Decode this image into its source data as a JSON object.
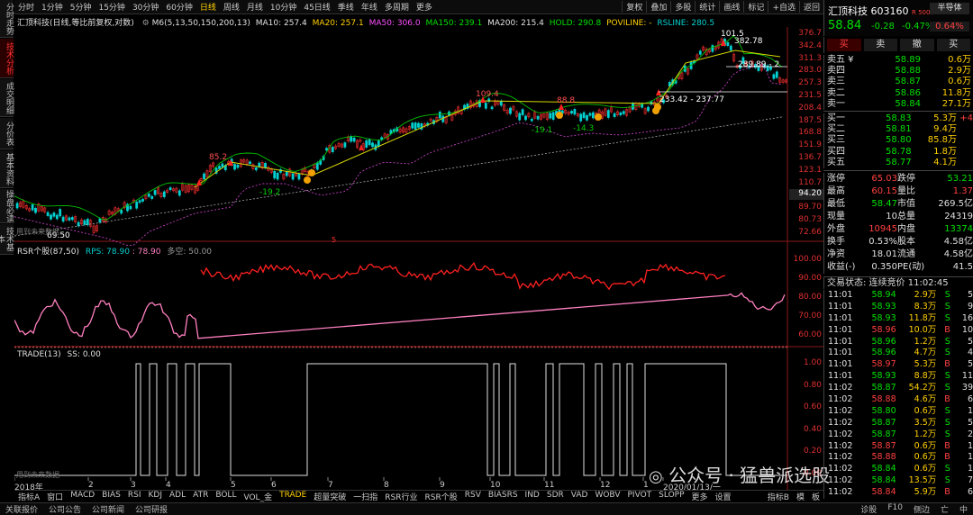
{
  "side_tabs": [
    {
      "label": "分时走势",
      "active": false
    },
    {
      "label": "技术分析",
      "active": true
    },
    {
      "label": "成交明细",
      "active": false
    },
    {
      "label": "分价表",
      "active": false
    },
    {
      "label": "基本资料",
      "active": false
    },
    {
      "label": "操盘必读",
      "active": false
    },
    {
      "label": "技术基本",
      "active": false
    }
  ],
  "timeframes": [
    "分时",
    "1分钟",
    "5分钟",
    "15分钟",
    "30分钟",
    "60分钟",
    "日线",
    "周线",
    "月线",
    "10分钟",
    "45日线",
    "季线",
    "年线",
    "多周期",
    "更多"
  ],
  "active_timeframe": "日线",
  "top_buttons": [
    "复权",
    "叠加",
    "多股",
    "统计",
    "画线",
    "标记",
    "+自选",
    "返回"
  ],
  "ma_line": {
    "name": "汇顶科技(日线,等比前复权,对数)",
    "m6": "M6(5,13,50,150,200,13)",
    "ma10": "MA10: 257.4",
    "ma20": "MA20: 257.1",
    "ma50": "MA50: 306.0",
    "ma150": "MA150: 239.1",
    "ma200": "MA200: 215.4",
    "hold": "HOLD: 290.8",
    "poviline": "POVILINE: -",
    "rsline": "RSLINE: 280.5"
  },
  "price_axis": [
    "376.7",
    "342.4",
    "311.3",
    "283.0",
    "257.3",
    "231.5",
    "208.4",
    "187.5",
    "168.8",
    "151.9",
    "136.7",
    "123.1",
    "110.7",
    "94.20",
    "89.70",
    "80.73",
    "72.66"
  ],
  "annotations": {
    "a1": "101.5",
    "a2": "382.78",
    "a3": "289.89 - 2",
    "a4": "233.42 - 237.77",
    "a5": "109.4",
    "a6": "88.8",
    "a7": "-19.1",
    "a8": "-14.3",
    "a9": "85.2",
    "a10": "-19.2",
    "a11": "69.50",
    "a12": "5",
    "a13": "用到未来数据"
  },
  "rsr_panel": {
    "title": "RSR个股(87,50)",
    "rps": "RPS: 78.90",
    "rps2": ": 78.90",
    "duo": "多空: 50.00",
    "axis": [
      "100.00",
      "90.00",
      "80.00",
      "70.00",
      "60.00"
    ]
  },
  "trade_panel": {
    "title": "TRADE(13)",
    "ss": "SS: 0.00",
    "axis": [
      "1.00",
      "0.80",
      "0.60",
      "0.40",
      "0.20",
      "0.00"
    ],
    "future": "用到未来数据"
  },
  "x_axis": [
    "2018年",
    "2",
    "3",
    "4",
    "5",
    "6",
    "7",
    "8",
    "9",
    "10",
    "11",
    "12",
    "1",
    "2020/01/13/一"
  ],
  "bottom_tabs": [
    "指标A",
    "窗口",
    "MACD",
    "BIAS",
    "RSI",
    "KDJ",
    "ADL",
    "ATR",
    "BOLL",
    "VOL_金",
    "TRADE",
    "超量突破",
    "一扫指",
    "RSR行业",
    "RSR个股",
    "RSV",
    "BIASRS",
    "IND",
    "SDR",
    "VAD",
    "WOBV",
    "PIVOT",
    "SLOPP",
    "更多",
    "设置"
  ],
  "active_bottom": "TRADE",
  "bottom_right": [
    "指标B",
    "模",
    "板"
  ],
  "status": {
    "items": [
      "关联报价",
      "公司公告",
      "公司新闻",
      "公司研报"
    ],
    "right": [
      "诊股",
      "F10",
      "侧边",
      "亡",
      "中"
    ]
  },
  "watermark": "公众号 · 猛兽派选股",
  "stock": {
    "name": "汇顶科技",
    "code": "603160",
    "tag": "R 500",
    "sector": "半导体",
    "price": "58.84",
    "change": "-0.28",
    "pct": "-0.47%",
    "sector_pct": "0.64%"
  },
  "trade_buttons": [
    "买",
    "卖",
    "撤",
    "买"
  ],
  "asks": [
    [
      "卖五 ¥",
      "58.89",
      "0.6万"
    ],
    [
      "卖四",
      "58.88",
      "2.9万"
    ],
    [
      "卖三",
      "58.87",
      "0.6万"
    ],
    [
      "卖二",
      "58.86",
      "11.8万"
    ],
    [
      "卖一",
      "58.84",
      "27.1万"
    ]
  ],
  "bids": [
    [
      "买一",
      "58.83",
      "5.3万",
      "+4"
    ],
    [
      "买二",
      "58.81",
      "9.4万",
      ""
    ],
    [
      "买三",
      "58.80",
      "85.8万",
      ""
    ],
    [
      "买四",
      "58.78",
      "1.8万",
      ""
    ],
    [
      "买五",
      "58.77",
      "4.1万",
      ""
    ]
  ],
  "stats": [
    [
      "涨停",
      "65.03",
      "跌停",
      "53.21"
    ],
    [
      "最高",
      "60.15",
      "量比",
      "1.37"
    ],
    [
      "最低",
      "58.47",
      "市值",
      "269.5亿"
    ],
    [
      "现量",
      "10",
      "总量",
      "24319"
    ],
    [
      "外盘",
      "10945",
      "内盘",
      "13374"
    ],
    [
      "换手",
      "0.53%",
      "股本",
      "4.58亿"
    ],
    [
      "净资",
      "18.01",
      "流通",
      "4.58亿"
    ],
    [
      "收益(-)",
      "0.350",
      "PE(动)",
      "41.5"
    ]
  ],
  "trade_status": "交易状态: 连续竞价 11:02:45",
  "ticks": [
    [
      "11:01",
      "58.94",
      "2.9万",
      "S",
      "5"
    ],
    [
      "11:01",
      "58.93",
      "8.3万",
      "S",
      "9"
    ],
    [
      "11:01",
      "58.93",
      "11.8万",
      "S",
      "16"
    ],
    [
      "11:01",
      "58.96",
      "10.0万",
      "B",
      "10"
    ],
    [
      "11:01",
      "58.96",
      "1.2万",
      "S",
      "5"
    ],
    [
      "11:01",
      "58.96",
      "4.7万",
      "S",
      "4"
    ],
    [
      "11:01",
      "58.97",
      "5.3万",
      "B",
      "5"
    ],
    [
      "11:01",
      "58.93",
      "8.8万",
      "S",
      "11"
    ],
    [
      "11:02",
      "58.87",
      "54.2万",
      "S",
      "39"
    ],
    [
      "11:02",
      "58.88",
      "4.6万",
      "B",
      "6"
    ],
    [
      "11:02",
      "58.80",
      "0.6万",
      "S",
      "1"
    ],
    [
      "11:02",
      "58.87",
      "3.5万",
      "S",
      "5"
    ],
    [
      "11:02",
      "58.87",
      "1.2万",
      "S",
      "2"
    ],
    [
      "11:02",
      "58.87",
      "0.6万",
      "B",
      "1"
    ],
    [
      "11:02",
      "58.88",
      "0.6万",
      "B",
      "1"
    ],
    [
      "11:02",
      "58.84",
      "0.6万",
      "S",
      "1"
    ],
    [
      "11:02",
      "58.84",
      "13.5万",
      "S",
      "7"
    ],
    [
      "11:02",
      "58.84",
      "5.9万",
      "B",
      "6"
    ]
  ]
}
